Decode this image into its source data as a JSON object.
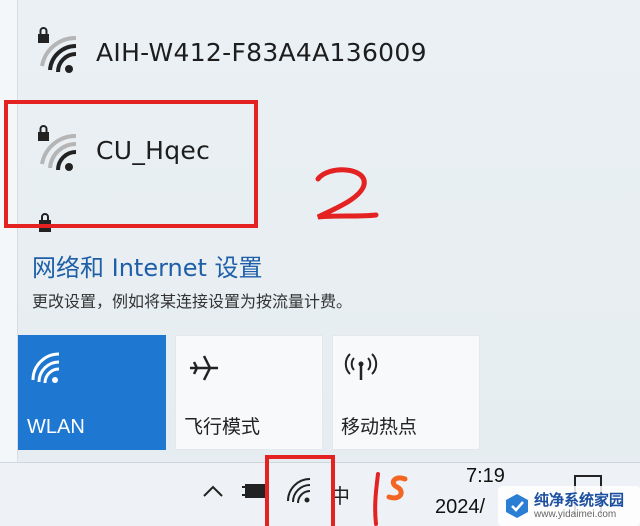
{
  "networks": [
    {
      "name": "AIH-W412-F83A4A136009",
      "secured": true
    },
    {
      "name": "CU_Hqec",
      "secured": true
    }
  ],
  "settings": {
    "title": "网络和 Internet 设置",
    "description": "更改设置，例如将某连接设置为按流量计费。"
  },
  "quick_actions": [
    {
      "label": "WLAN",
      "active": true,
      "icon": "wifi-icon"
    },
    {
      "label": "飞行模式",
      "active": false,
      "icon": "airplane-icon"
    },
    {
      "label": "移动热点",
      "active": false,
      "icon": "hotspot-icon"
    }
  ],
  "taskbar": {
    "ime_label": "中",
    "time": "7:19",
    "date": "2024/"
  },
  "annotation": {
    "label": "2",
    "color": "#e42222"
  },
  "watermark": {
    "title": "纯净系统家园",
    "url": "www.yidaimei.com"
  },
  "colors": {
    "accent": "#1e78d2",
    "link": "#1e5fa8",
    "annotation": "#e42222"
  }
}
